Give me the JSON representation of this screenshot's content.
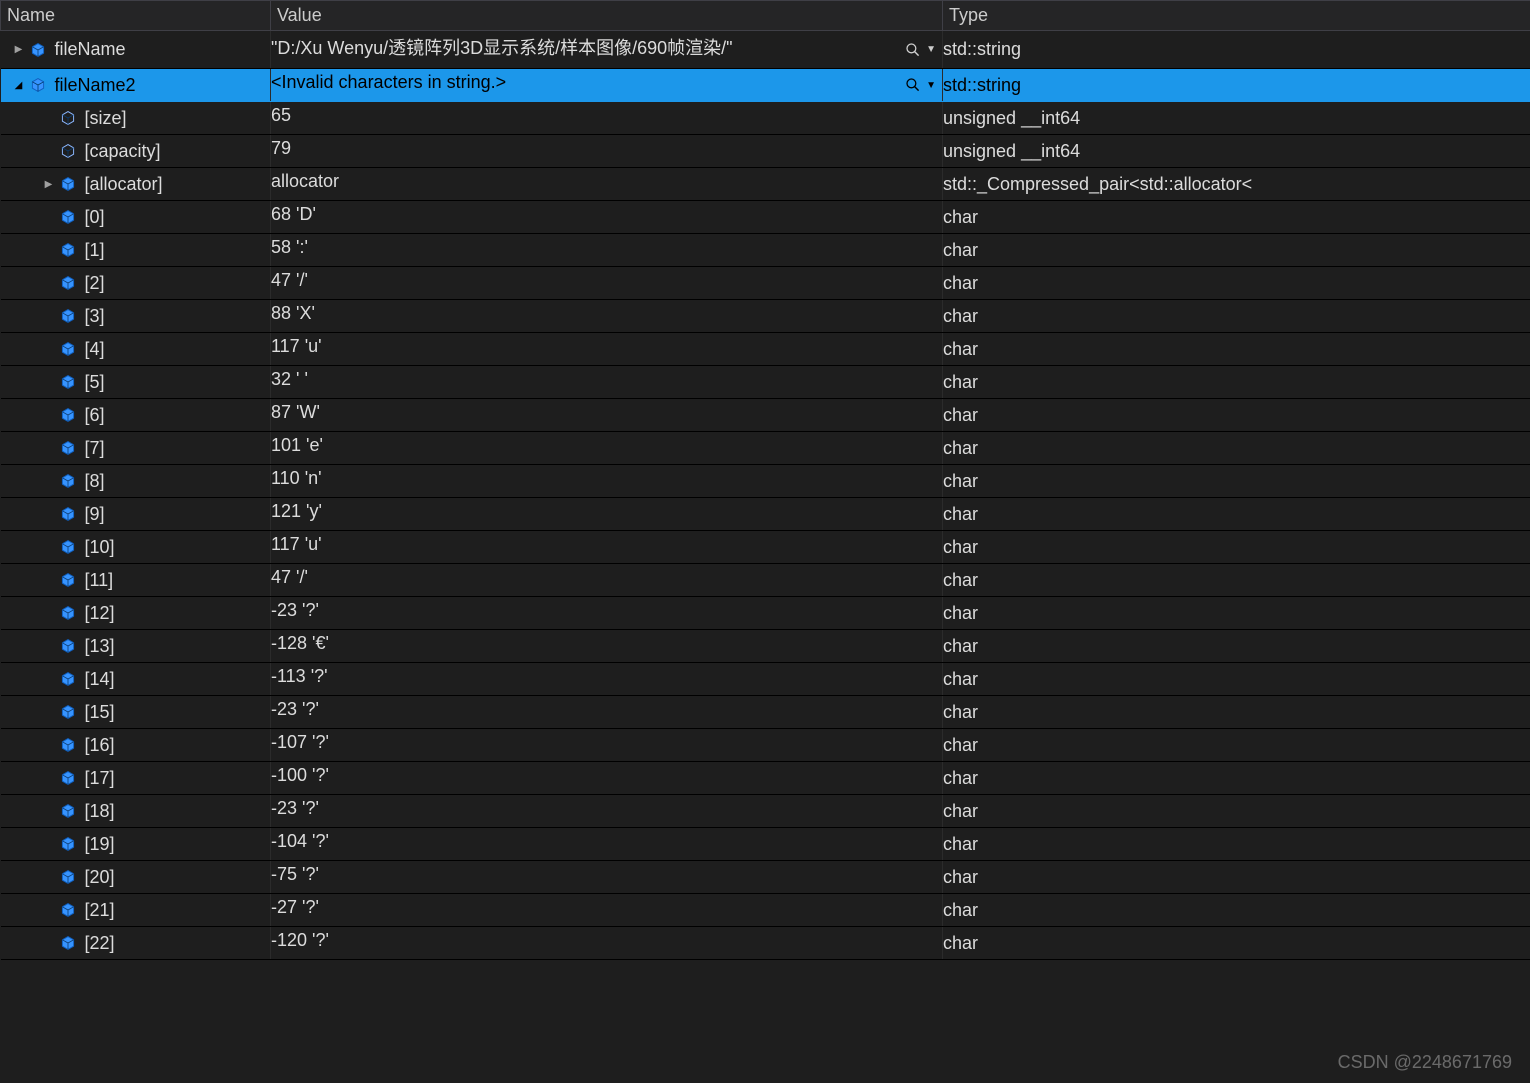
{
  "header": {
    "name": "Name",
    "value": "Value",
    "type": "Type"
  },
  "rows": [
    {
      "depth": 0,
      "expander": "right",
      "iconStyle": "solid",
      "selected": false,
      "name": "fileName",
      "value": "\"D:/Xu Wenyu/透镜阵列3D显示系统/样本图像/690帧渲染/\"",
      "type": "std::string",
      "actions": true
    },
    {
      "depth": 0,
      "expander": "down",
      "iconStyle": "solid",
      "selected": true,
      "name": "fileName2",
      "value": "<Invalid characters in string.>",
      "type": "std::string",
      "actions": true
    },
    {
      "depth": 1,
      "expander": "none",
      "iconStyle": "outline",
      "selected": false,
      "name": "[size]",
      "value": "65",
      "type": "unsigned __int64"
    },
    {
      "depth": 1,
      "expander": "none",
      "iconStyle": "outline",
      "selected": false,
      "name": "[capacity]",
      "value": "79",
      "type": "unsigned __int64"
    },
    {
      "depth": 1,
      "expander": "right",
      "iconStyle": "solid",
      "selected": false,
      "name": "[allocator]",
      "value": "allocator",
      "type": "std::_Compressed_pair<std::allocator<"
    },
    {
      "depth": 1,
      "expander": "none",
      "iconStyle": "solid",
      "selected": false,
      "name": "[0]",
      "value": "68 'D'",
      "type": "char"
    },
    {
      "depth": 1,
      "expander": "none",
      "iconStyle": "solid",
      "selected": false,
      "name": "[1]",
      "value": "58 ':'",
      "type": "char"
    },
    {
      "depth": 1,
      "expander": "none",
      "iconStyle": "solid",
      "selected": false,
      "name": "[2]",
      "value": "47 '/'",
      "type": "char"
    },
    {
      "depth": 1,
      "expander": "none",
      "iconStyle": "solid",
      "selected": false,
      "name": "[3]",
      "value": "88 'X'",
      "type": "char"
    },
    {
      "depth": 1,
      "expander": "none",
      "iconStyle": "solid",
      "selected": false,
      "name": "[4]",
      "value": "117 'u'",
      "type": "char"
    },
    {
      "depth": 1,
      "expander": "none",
      "iconStyle": "solid",
      "selected": false,
      "name": "[5]",
      "value": "32 ' '",
      "type": "char"
    },
    {
      "depth": 1,
      "expander": "none",
      "iconStyle": "solid",
      "selected": false,
      "name": "[6]",
      "value": "87 'W'",
      "type": "char"
    },
    {
      "depth": 1,
      "expander": "none",
      "iconStyle": "solid",
      "selected": false,
      "name": "[7]",
      "value": "101 'e'",
      "type": "char"
    },
    {
      "depth": 1,
      "expander": "none",
      "iconStyle": "solid",
      "selected": false,
      "name": "[8]",
      "value": "110 'n'",
      "type": "char"
    },
    {
      "depth": 1,
      "expander": "none",
      "iconStyle": "solid",
      "selected": false,
      "name": "[9]",
      "value": "121 'y'",
      "type": "char"
    },
    {
      "depth": 1,
      "expander": "none",
      "iconStyle": "solid",
      "selected": false,
      "name": "[10]",
      "value": "117 'u'",
      "type": "char"
    },
    {
      "depth": 1,
      "expander": "none",
      "iconStyle": "solid",
      "selected": false,
      "name": "[11]",
      "value": "47 '/'",
      "type": "char"
    },
    {
      "depth": 1,
      "expander": "none",
      "iconStyle": "solid",
      "selected": false,
      "name": "[12]",
      "value": "-23 '?'",
      "type": "char"
    },
    {
      "depth": 1,
      "expander": "none",
      "iconStyle": "solid",
      "selected": false,
      "name": "[13]",
      "value": "-128 '€'",
      "type": "char"
    },
    {
      "depth": 1,
      "expander": "none",
      "iconStyle": "solid",
      "selected": false,
      "name": "[14]",
      "value": "-113 '?'",
      "type": "char"
    },
    {
      "depth": 1,
      "expander": "none",
      "iconStyle": "solid",
      "selected": false,
      "name": "[15]",
      "value": "-23 '?'",
      "type": "char"
    },
    {
      "depth": 1,
      "expander": "none",
      "iconStyle": "solid",
      "selected": false,
      "name": "[16]",
      "value": "-107 '?'",
      "type": "char"
    },
    {
      "depth": 1,
      "expander": "none",
      "iconStyle": "solid",
      "selected": false,
      "name": "[17]",
      "value": "-100 '?'",
      "type": "char"
    },
    {
      "depth": 1,
      "expander": "none",
      "iconStyle": "solid",
      "selected": false,
      "name": "[18]",
      "value": "-23 '?'",
      "type": "char"
    },
    {
      "depth": 1,
      "expander": "none",
      "iconStyle": "solid",
      "selected": false,
      "name": "[19]",
      "value": "-104 '?'",
      "type": "char"
    },
    {
      "depth": 1,
      "expander": "none",
      "iconStyle": "solid",
      "selected": false,
      "name": "[20]",
      "value": "-75 '?'",
      "type": "char"
    },
    {
      "depth": 1,
      "expander": "none",
      "iconStyle": "solid",
      "selected": false,
      "name": "[21]",
      "value": "-27 '?'",
      "type": "char"
    },
    {
      "depth": 1,
      "expander": "none",
      "iconStyle": "solid",
      "selected": false,
      "name": "[22]",
      "value": "-120 '?'",
      "type": "char"
    }
  ],
  "watermark": "CSDN @2248671769",
  "glyphs": {
    "expand_right": "▶",
    "expand_down": "◢",
    "dropdown": "▼"
  },
  "colors": {
    "selection": "#1c97ea",
    "iconBlue": "#3794ff",
    "iconOutline": "#8bb7ff"
  }
}
